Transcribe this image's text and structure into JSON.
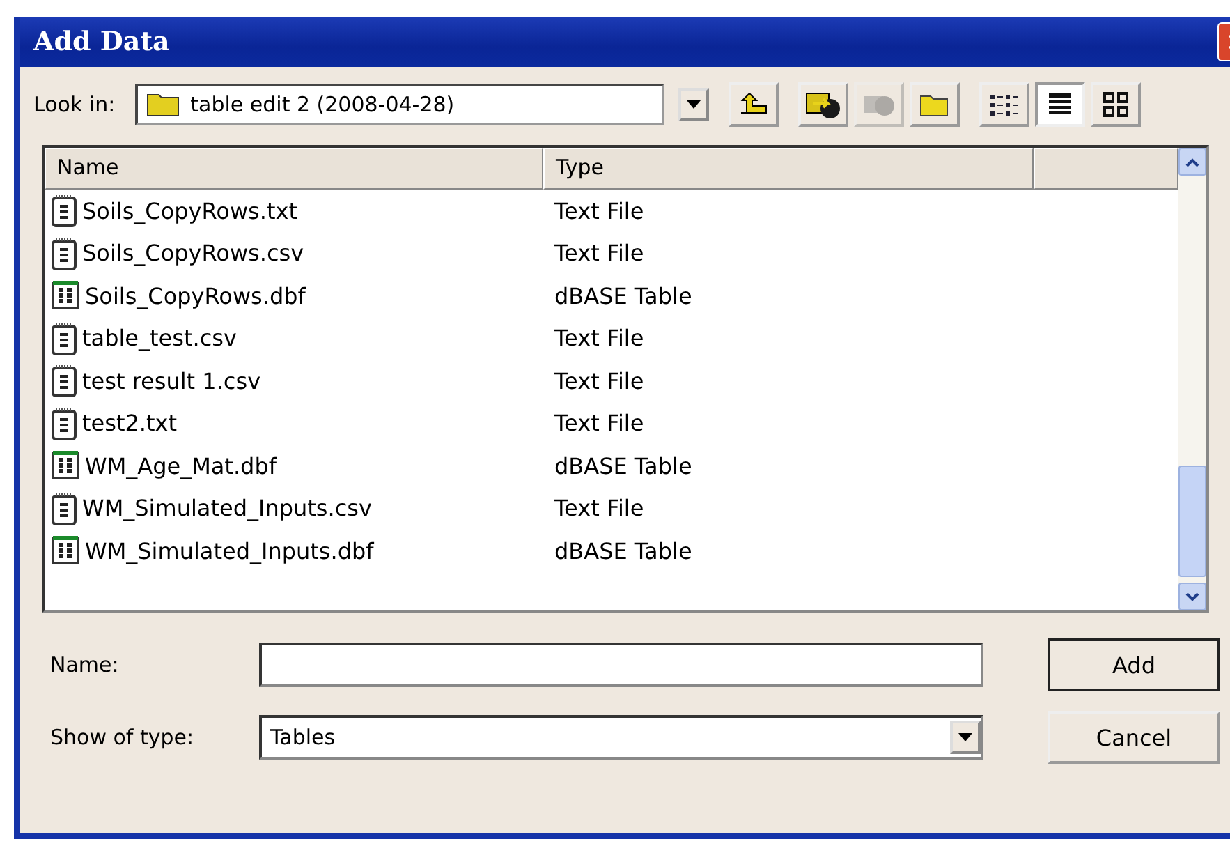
{
  "window": {
    "title": "Add Data"
  },
  "look_in": {
    "label": "Look in:",
    "value": "table edit 2 (2008-04-28)"
  },
  "toolbar": [
    {
      "kind": "up"
    },
    {
      "kind": "connect"
    },
    {
      "kind": "disconnect",
      "disabled": true
    },
    {
      "kind": "newfolder"
    },
    {
      "kind": "list"
    },
    {
      "kind": "details",
      "selected": true
    },
    {
      "kind": "thumbnails"
    }
  ],
  "file_list": {
    "columns": [
      "Name",
      "Type"
    ],
    "rows": [
      {
        "name": "Soils_CopyRows.txt",
        "type": "Text File",
        "kind": "text"
      },
      {
        "name": "Soils_CopyRows.csv",
        "type": "Text File",
        "kind": "text"
      },
      {
        "name": "Soils_CopyRows.dbf",
        "type": "dBASE Table",
        "kind": "table"
      },
      {
        "name": "table_test.csv",
        "type": "Text File",
        "kind": "text"
      },
      {
        "name": "test result 1.csv",
        "type": "Text File",
        "kind": "text"
      },
      {
        "name": "test2.txt",
        "type": "Text File",
        "kind": "text"
      },
      {
        "name": "WM_Age_Mat.dbf",
        "type": "dBASE Table",
        "kind": "table"
      },
      {
        "name": "WM_Simulated_Inputs.csv",
        "type": "Text File",
        "kind": "text"
      },
      {
        "name": "WM_Simulated_Inputs.dbf",
        "type": "dBASE Table",
        "kind": "table"
      }
    ]
  },
  "name_field": {
    "label": "Name:"
  },
  "type_field": {
    "label": "Show of type:",
    "value": "Tables"
  },
  "buttons": [
    "Add",
    "Cancel"
  ]
}
